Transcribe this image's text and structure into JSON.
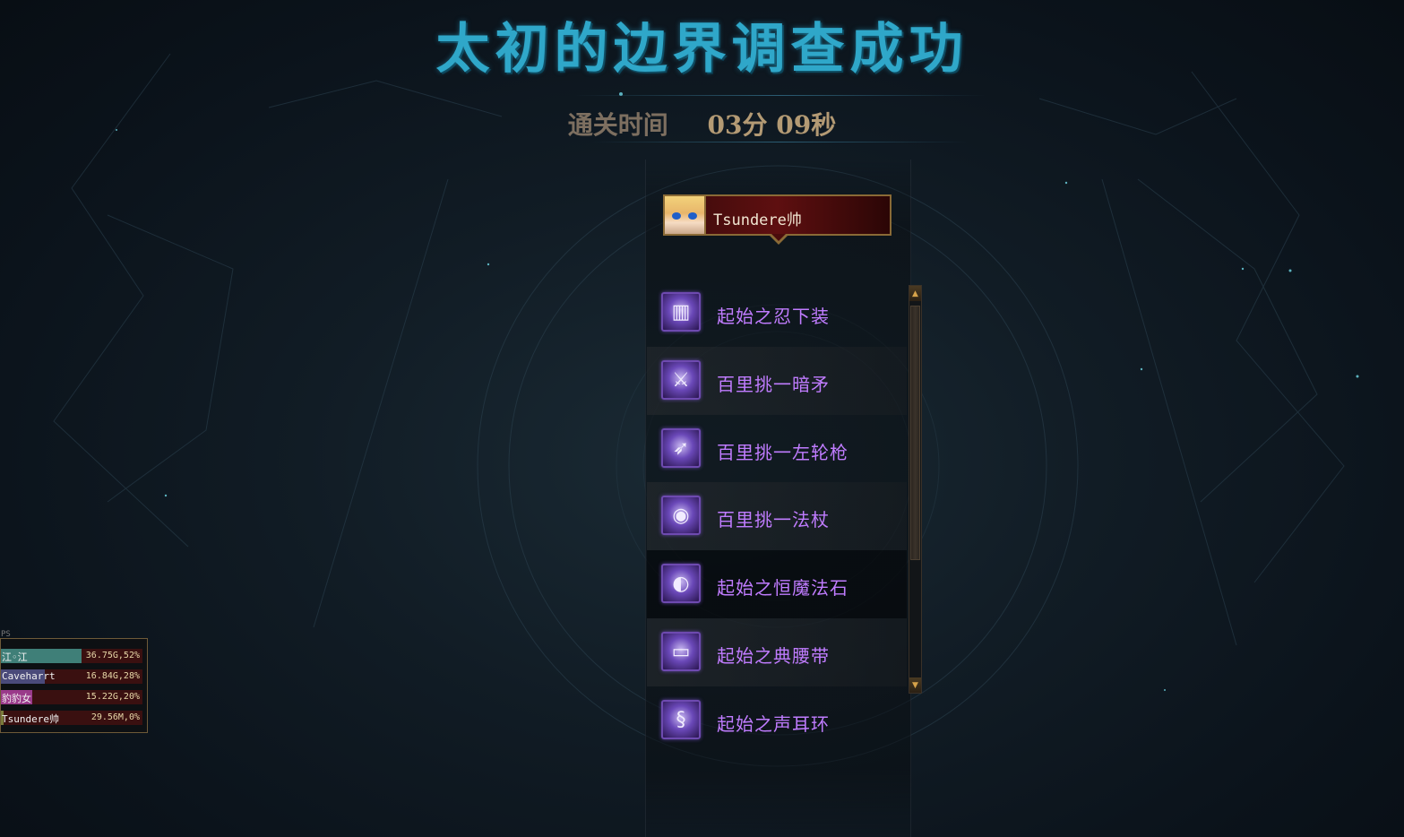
{
  "title": "太初的边界调查成功",
  "clear_time": {
    "label": "通关时间",
    "value": "03分 09秒"
  },
  "player": {
    "name": "Tsundere帅"
  },
  "items": [
    {
      "name": "起始之忍下装",
      "icon": "pants-icon"
    },
    {
      "name": "百里挑一暗矛",
      "icon": "spear-icon"
    },
    {
      "name": "百里挑一左轮枪",
      "icon": "revolver-icon"
    },
    {
      "name": "百里挑一法杖",
      "icon": "staff-icon"
    },
    {
      "name": "起始之恒魔法石",
      "icon": "magic-stone-icon"
    },
    {
      "name": "起始之典腰带",
      "icon": "belt-icon"
    },
    {
      "name": "起始之声耳环",
      "icon": "earring-icon"
    }
  ],
  "dps_meter": {
    "title": "PS",
    "rows": [
      {
        "name": "江◦江",
        "value": "36.75G,52%",
        "share": 0.52,
        "color": "#3f7f78"
      },
      {
        "name": "Caveharrt",
        "value": "16.84G,28%",
        "share": 0.28,
        "color": "#4a4a7a"
      },
      {
        "name": "豹豹女",
        "value": "15.22G,20%",
        "share": 0.2,
        "color": "#9a3a8a"
      },
      {
        "name": "Tsundere帅",
        "value": "29.56M,0%",
        "share": 0.0,
        "color": "#7a7a3a"
      }
    ]
  }
}
